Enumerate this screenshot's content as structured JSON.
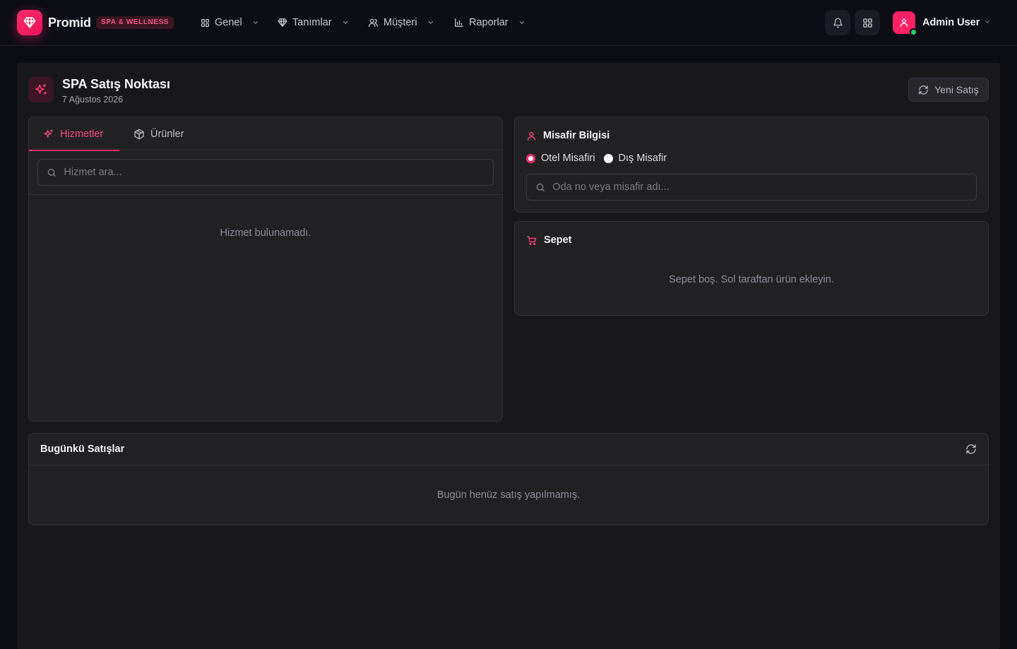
{
  "brand": {
    "name": "Promid",
    "badge": "SPA & WELLNESS",
    "logo_icon": "diamond-icon",
    "accent_color": "#ff2d6a"
  },
  "nav": {
    "items": [
      {
        "label": "Genel",
        "icon": "grid-icon"
      },
      {
        "label": "Tanımlar",
        "icon": "diamond-icon"
      },
      {
        "label": "Müşteri",
        "icon": "users-icon"
      },
      {
        "label": "Raporlar",
        "icon": "bar-chart-icon"
      }
    ]
  },
  "header_actions": {
    "notifications_icon": "bell-icon",
    "apps_icon": "apps-grid-icon"
  },
  "user": {
    "name": "Admin User",
    "status_color": "#1fcf72"
  },
  "page": {
    "title": "SPA Satış Noktası",
    "date": "7 Ağustos 2026",
    "new_sale_label": "Yeni Satış"
  },
  "catalog": {
    "tabs": [
      {
        "label": "Hizmetler",
        "icon": "sparkles-icon",
        "active": true
      },
      {
        "label": "Ürünler",
        "icon": "box-icon",
        "active": false
      }
    ],
    "search_placeholder": "Hizmet ara...",
    "empty_message": "Hizmet bulunamadı."
  },
  "guest": {
    "title": "Misafir Bilgisi",
    "options": [
      {
        "label": "Otel Misafiri",
        "selected": true
      },
      {
        "label": "Dış Misafir",
        "selected": false
      }
    ],
    "search_placeholder": "Oda no veya misafir adı..."
  },
  "cart": {
    "title": "Sepet",
    "empty_message": "Sepet boş. Sol taraftan ürün ekleyin."
  },
  "today_sales": {
    "title": "Bugünkü Satışlar",
    "empty_message": "Bugün henüz satış yapılmamış."
  }
}
